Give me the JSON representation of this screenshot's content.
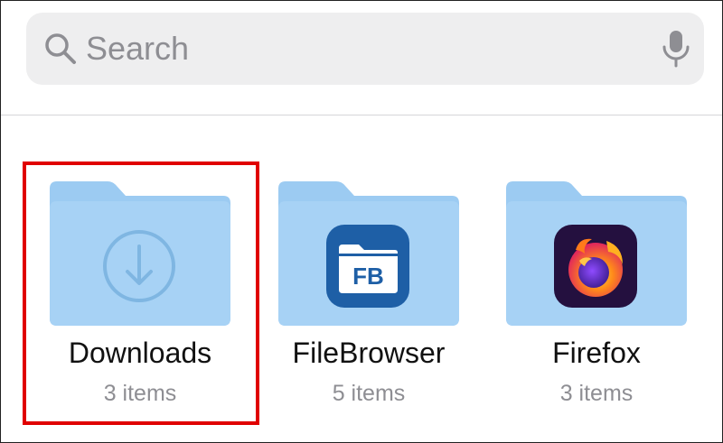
{
  "search": {
    "placeholder": "Search",
    "leading_icon": "search-icon",
    "trailing_icon": "microphone-icon"
  },
  "folders": [
    {
      "name": "Downloads",
      "count": "3 items",
      "icon": "download-arrow-icon",
      "highlighted": true
    },
    {
      "name": "FileBrowser",
      "count": "5 items",
      "icon": "filebrowser-app-icon",
      "badge_text": "FB"
    },
    {
      "name": "Firefox",
      "count": "3 items",
      "icon": "firefox-app-icon"
    }
  ],
  "colors": {
    "folder": "#a7d2f5",
    "folder_tab": "#9ccbf2",
    "highlight": "#e00000",
    "secondary_text": "#8e8e93",
    "search_bg": "#eeeeef",
    "filebrowser_blue": "#1e5fa6"
  }
}
